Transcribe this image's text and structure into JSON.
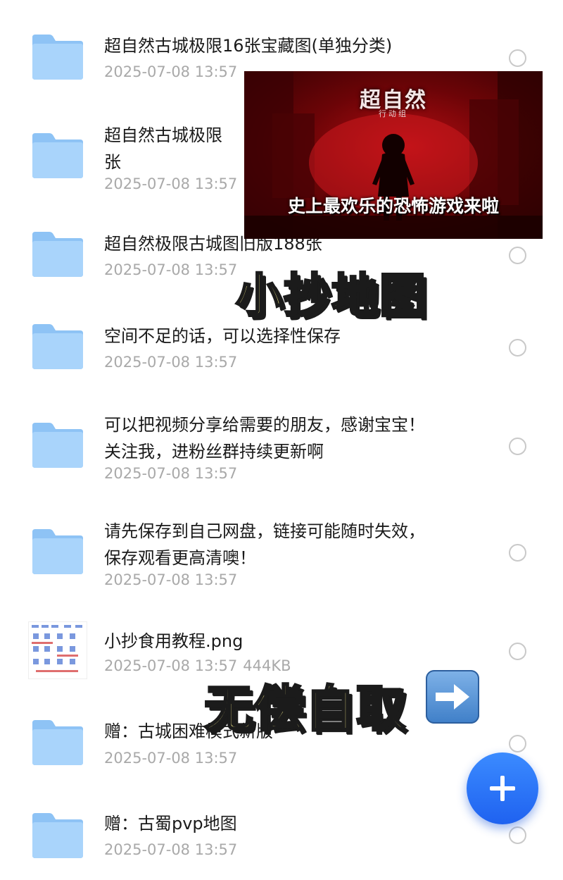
{
  "files": [
    {
      "type": "folder",
      "title_lines": [
        "超自然古城极限16张宝藏图(单独分类)"
      ],
      "date": "2025-07-08 13:57"
    },
    {
      "type": "folder",
      "title_lines": [
        "超自然古城极限",
        "张"
      ],
      "date": "2025-07-08 13:57"
    },
    {
      "type": "folder",
      "title_lines": [
        "超自然极限古城图旧版188张"
      ],
      "date": "2025-07-08 13:57"
    },
    {
      "type": "folder",
      "title_lines": [
        "空间不足的话，可以选择性保存"
      ],
      "date": "2025-07-08 13:57"
    },
    {
      "type": "folder",
      "title_lines": [
        "可以把视频分享给需要的朋友，感谢宝宝！",
        "关注我，进粉丝群持续更新啊"
      ],
      "date": "2025-07-08 13:57"
    },
    {
      "type": "folder",
      "title_lines": [
        "请先保存到自己网盘，链接可能随时失效，",
        "保存观看更高清噢！"
      ],
      "date": "2025-07-08 13:57"
    },
    {
      "type": "image",
      "title_lines": [
        "小抄食用教程.png"
      ],
      "date": "2025-07-08 13:57",
      "size": "444KB"
    },
    {
      "type": "folder",
      "title_lines": [
        "赠：古城困难模式新版"
      ],
      "date": "2025-07-08 13:57"
    },
    {
      "type": "folder",
      "title_lines": [
        "赠：古蜀pvp地图"
      ],
      "date": "2025-07-08 13:57"
    }
  ],
  "banner": {
    "logo": "超自然",
    "logo_sub": "行动组",
    "caption": "史上最欢乐的恐怖游戏来啦"
  },
  "overlay": {
    "text_1": "小抄地图",
    "text_2": "无偿自取"
  },
  "icons": {
    "folder": "folder-icon",
    "arrow": "right-arrow-icon",
    "fab": "plus-icon",
    "select": "radio-circle-icon"
  },
  "colors": {
    "folder_light": "#a9d4fb",
    "folder_dark": "#7bb8f0",
    "fab": "#2f7bf6",
    "overlay_text": "#f7ee8a"
  }
}
